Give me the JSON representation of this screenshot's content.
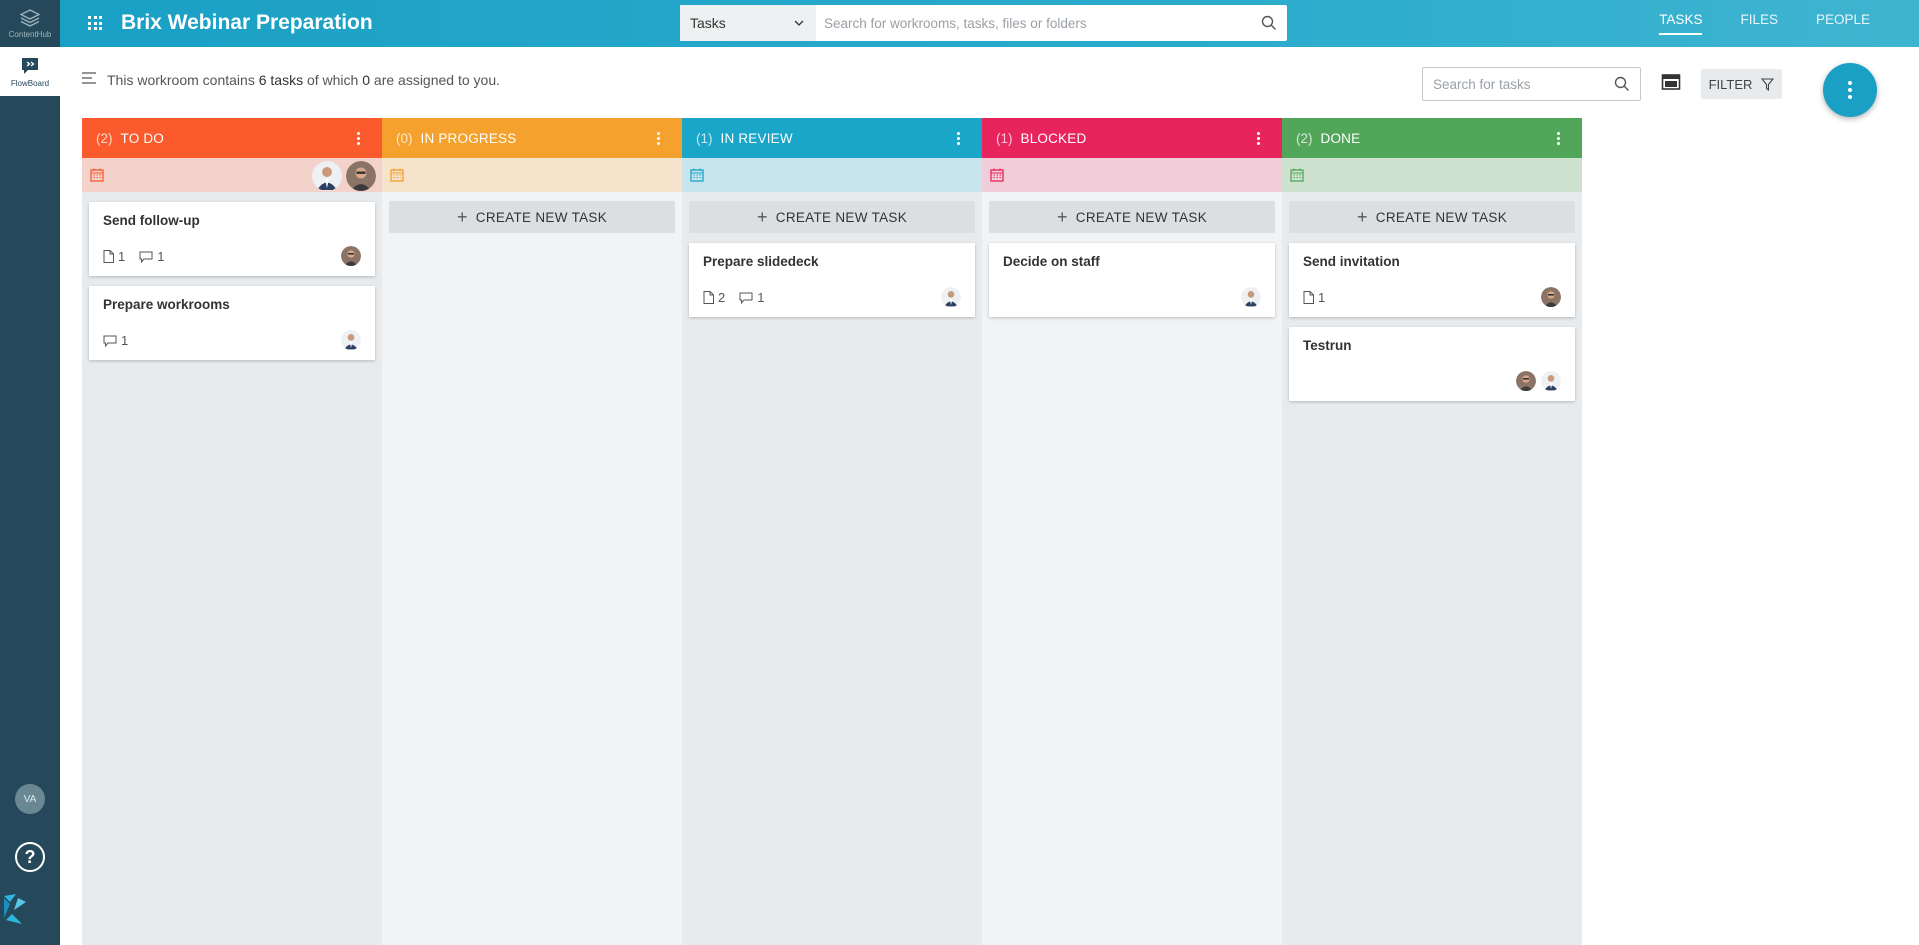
{
  "rail": {
    "apps": [
      {
        "label": "ContentHub",
        "icon": "layers-icon"
      },
      {
        "label": "FlowBoard",
        "icon": "flowboard-icon"
      }
    ],
    "user_initials": "VA",
    "help_label": "?"
  },
  "header": {
    "title": "Brix Webinar Preparation",
    "search_scope": "Tasks",
    "search_placeholder": "Search for workrooms, tasks, files or folders",
    "nav": [
      "TASKS",
      "FILES",
      "PEOPLE"
    ],
    "active_nav": "TASKS"
  },
  "summary": {
    "prefix": "This workroom contains",
    "task_count": "6 tasks",
    "middle": "of which",
    "assigned_count": "0",
    "suffix": "are assigned to you."
  },
  "toolbar": {
    "task_search_placeholder": "Search for tasks",
    "filter_label": "FILTER"
  },
  "colors": {
    "todo": "#fa5a2c",
    "in_progress": "#f4a12e",
    "in_review": "#1aa6c8",
    "blocked": "#e8245c",
    "done": "#52a65a"
  },
  "create_label": "CREATE NEW TASK",
  "columns": [
    {
      "count": "(2)",
      "label": "TO DO",
      "cards": [
        {
          "title": "Send follow-up",
          "files": "1",
          "comments": "1"
        },
        {
          "title": "Prepare workrooms",
          "comments": "1"
        }
      ]
    },
    {
      "count": "(0)",
      "label": "IN PROGRESS",
      "cards": []
    },
    {
      "count": "(1)",
      "label": "IN REVIEW",
      "cards": [
        {
          "title": "Prepare slidedeck",
          "files": "2",
          "comments": "1"
        }
      ]
    },
    {
      "count": "(1)",
      "label": "BLOCKED",
      "cards": [
        {
          "title": "Decide on staff"
        }
      ]
    },
    {
      "count": "(2)",
      "label": "DONE",
      "cards": [
        {
          "title": "Send invitation",
          "files": "1"
        },
        {
          "title": "Testrun"
        }
      ]
    }
  ]
}
